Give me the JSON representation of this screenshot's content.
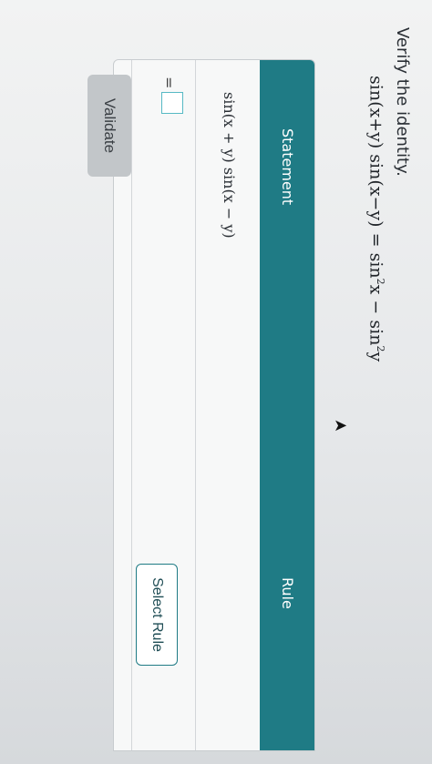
{
  "instruction": "Verify the identity.",
  "identity": {
    "lhs": "sin(x+y) sin(x−y)",
    "eq": "=",
    "rhs_a": "sin",
    "rhs_a_exp": "2",
    "rhs_a_arg": "x",
    "rhs_minus": "−",
    "rhs_b": "sin",
    "rhs_b_exp": "2",
    "rhs_b_arg": "y"
  },
  "table": {
    "headers": {
      "statement": "Statement",
      "rule": "Rule"
    },
    "rows": [
      {
        "statement": "sin(x + y) sin(x − y)"
      },
      {
        "prefix": "=",
        "rule_button": "Select Rule"
      }
    ]
  },
  "validate_label": "Validate",
  "colors": {
    "header_teal": "#1f7b85",
    "input_border": "#56b9c4"
  }
}
